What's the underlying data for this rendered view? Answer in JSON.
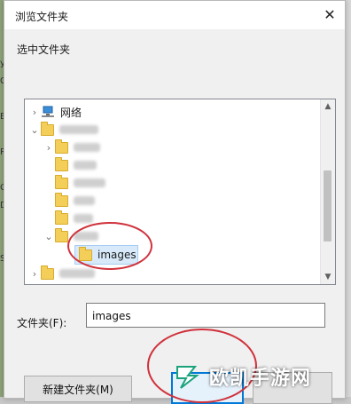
{
  "window": {
    "title": "浏览文件夹",
    "close_glyph": "✕"
  },
  "prompt": "选中文件夹",
  "tree": {
    "network_label": "网络",
    "selected_label": "images"
  },
  "folder_field": {
    "label": "文件夹(F):",
    "value": "images"
  },
  "buttons": {
    "new_folder": "新建文件夹(M)",
    "ok": "",
    "cancel": ""
  },
  "watermark": {
    "text": "欧凯手游网"
  },
  "colors": {
    "annotation": "#d0323c",
    "accent": "#0078d7",
    "folder": "#f3cf5a"
  }
}
